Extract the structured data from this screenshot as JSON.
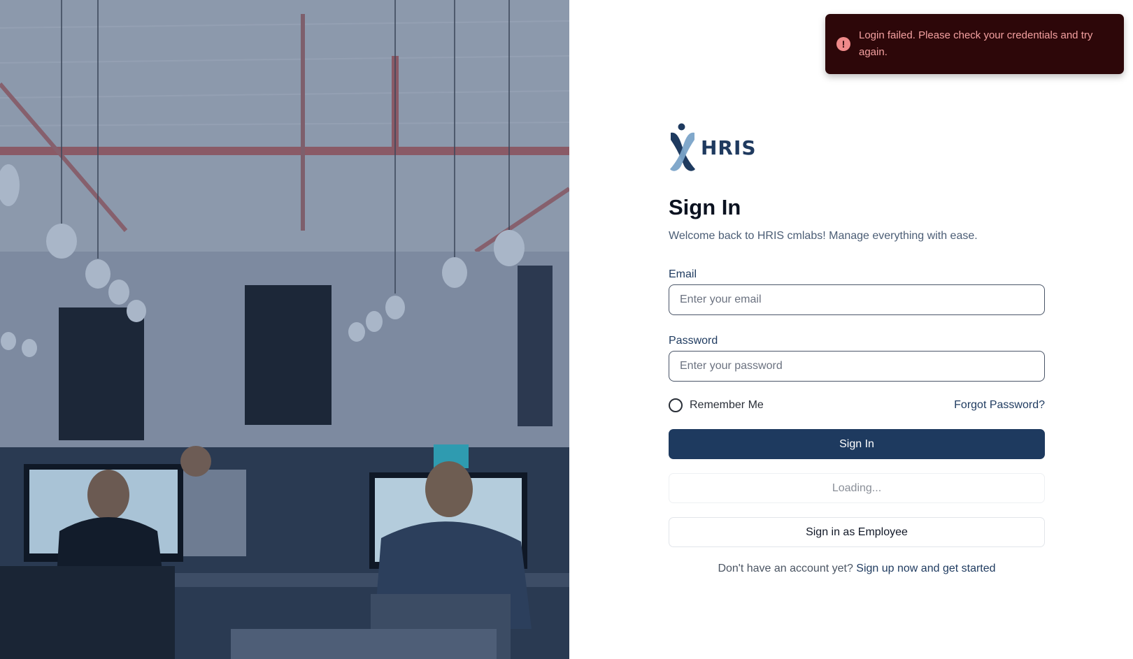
{
  "toast": {
    "icon": "alert-circle-icon",
    "message": "Login failed. Please check your credentials and try again."
  },
  "brand": {
    "logo_icon": "hris-person-logo-icon",
    "name": "HRIS"
  },
  "form": {
    "title": "Sign In",
    "subtitle": "Welcome back to HRIS cmlabs! Manage everything with ease.",
    "email_label": "Email",
    "email_placeholder": "Enter your email",
    "email_value": "",
    "password_label": "Password",
    "password_placeholder": "Enter your password",
    "password_value": "",
    "remember_label": "Remember Me",
    "remember_checked": false,
    "forgot_label": "Forgot Password?",
    "signin_label": "Sign In",
    "loading_label": "Loading...",
    "employee_label": "Sign in as Employee",
    "signup_prompt": "Don't have an account yet?",
    "signup_link": "Sign up now and get started"
  },
  "colors": {
    "primary": "#1e3a5f",
    "toast_bg": "#2d0709",
    "toast_text": "#f3a0a0"
  }
}
